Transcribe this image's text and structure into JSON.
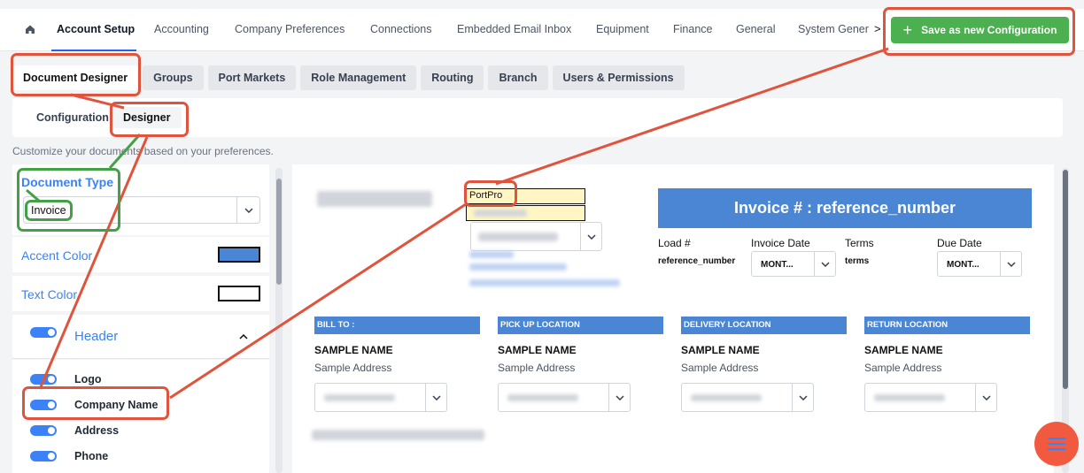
{
  "nav": {
    "tabs": [
      "Account Setup",
      "Accounting",
      "Company Preferences",
      "Connections",
      "Embedded Email Inbox",
      "Equipment",
      "Finance",
      "General",
      "System Gener"
    ],
    "more": ">",
    "save_button": "Save as new Configuration"
  },
  "subtabs": [
    "Document Designer",
    "Groups",
    "Port Markets",
    "Role Management",
    "Routing",
    "Branch",
    "Users & Permissions"
  ],
  "config_tabs": {
    "configuration": "Configuration",
    "designer": "Designer"
  },
  "description": "Customize your documents based on your preferences.",
  "left": {
    "document_type_label": "Document Type",
    "document_type_value": "Invoice",
    "accent_color_label": "Accent Color",
    "accent_color": "#4a86d4",
    "text_color_label": "Text Color",
    "text_color": "#ffffff",
    "header_label": "Header",
    "header_items": [
      "Logo",
      "Company Name",
      "Address",
      "Phone"
    ]
  },
  "preview": {
    "company_name": "PortPro",
    "invoice_title": "Invoice # : reference_number",
    "load_label": "Load #",
    "load_value": "reference_number",
    "invoice_date_label": "Invoice Date",
    "invoice_date_value": "MONT...",
    "terms_label": "Terms",
    "terms_value": "terms",
    "due_date_label": "Due Date",
    "due_date_value": "MONT...",
    "sections": [
      {
        "title": "BILL TO :",
        "name": "SAMPLE NAME",
        "address": "Sample Address"
      },
      {
        "title": "PICK UP LOCATION",
        "name": "SAMPLE NAME",
        "address": "Sample Address"
      },
      {
        "title": "DELIVERY LOCATION",
        "name": "SAMPLE NAME",
        "address": "Sample Address"
      },
      {
        "title": "RETURN LOCATION",
        "name": "SAMPLE NAME",
        "address": "Sample Address"
      }
    ]
  }
}
